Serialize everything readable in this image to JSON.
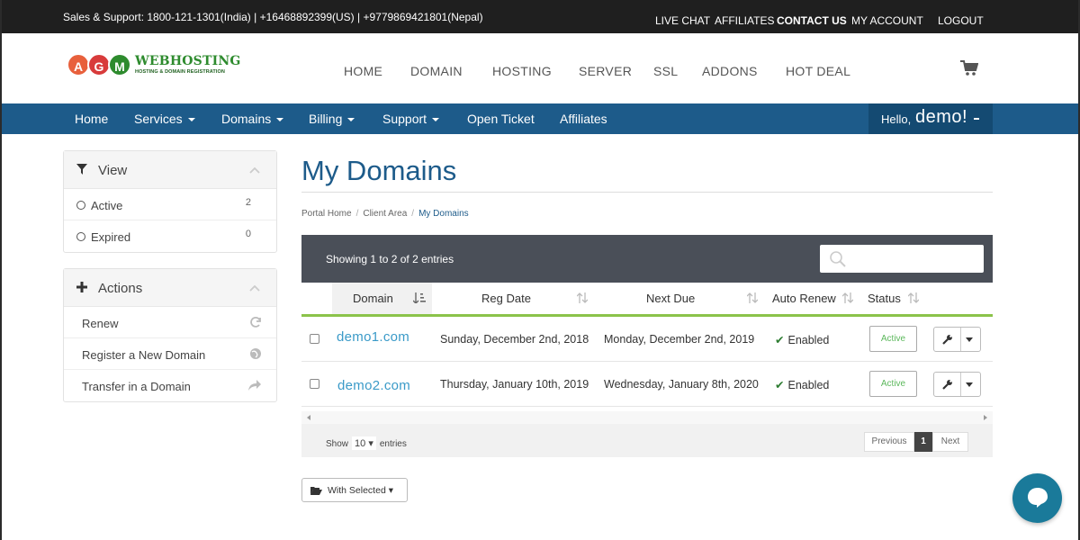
{
  "topbar": {
    "support": "Sales & Support: 1800-121-1301(India) | +16468892399(US) | +9779869421801(Nepal)",
    "links": [
      "LIVE CHAT",
      "AFFILIATES",
      "CONTACT US",
      "MY ACCOUNT",
      "LOGOUT"
    ]
  },
  "logo": {
    "letters": [
      "A",
      "G",
      "M"
    ],
    "brand": "WEBHOSTING",
    "tagline": "HOSTING & DOMAIN REGISTRATION"
  },
  "mainnav": [
    "HOME",
    "DOMAIN",
    "HOSTING",
    "SERVER",
    "SSL",
    "ADDONS",
    "HOT DEAL"
  ],
  "bluenav": {
    "items": [
      "Home",
      "Services",
      "Domains",
      "Billing",
      "Support",
      "Open Ticket",
      "Affiliates"
    ],
    "hello_prefix": "Hello,",
    "hello_name": "demo!"
  },
  "view_panel": {
    "title": "View",
    "items": [
      {
        "label": "Active",
        "count": "2"
      },
      {
        "label": "Expired",
        "count": "0"
      }
    ]
  },
  "actions_panel": {
    "title": "Actions",
    "items": [
      "Renew",
      "Register a New Domain",
      "Transfer in a Domain"
    ]
  },
  "page": {
    "title": "My Domains",
    "breadcrumb": [
      "Portal Home",
      "Client Area",
      "My Domains"
    ]
  },
  "table": {
    "info": "Showing 1 to 2 of 2 entries",
    "search_placeholder": "",
    "columns": [
      "Domain",
      "Reg Date",
      "Next Due",
      "Auto Renew",
      "Status"
    ],
    "rows": [
      {
        "domain": "demo1.com",
        "reg_date": "Sunday, December 2nd, 2018",
        "next_due": "Monday, December 2nd, 2019",
        "auto_renew": "Enabled",
        "status": "Active"
      },
      {
        "domain": "demo2.com",
        "reg_date": "Thursday, January 10th, 2019",
        "next_due": "Wednesday, January 8th, 2020",
        "auto_renew": "Enabled",
        "status": "Active"
      }
    ],
    "footer": {
      "show_label": "Show",
      "page_size": "10",
      "entries_label": "entries",
      "previous": "Previous",
      "current_page": "1",
      "next": "Next"
    }
  },
  "with_selected": "With Selected",
  "colors": {
    "brand_blue": "#1d5b8a",
    "topbar": "#1f1f1f",
    "accent_green": "#8bc34a",
    "link": "#3a9ac8"
  }
}
